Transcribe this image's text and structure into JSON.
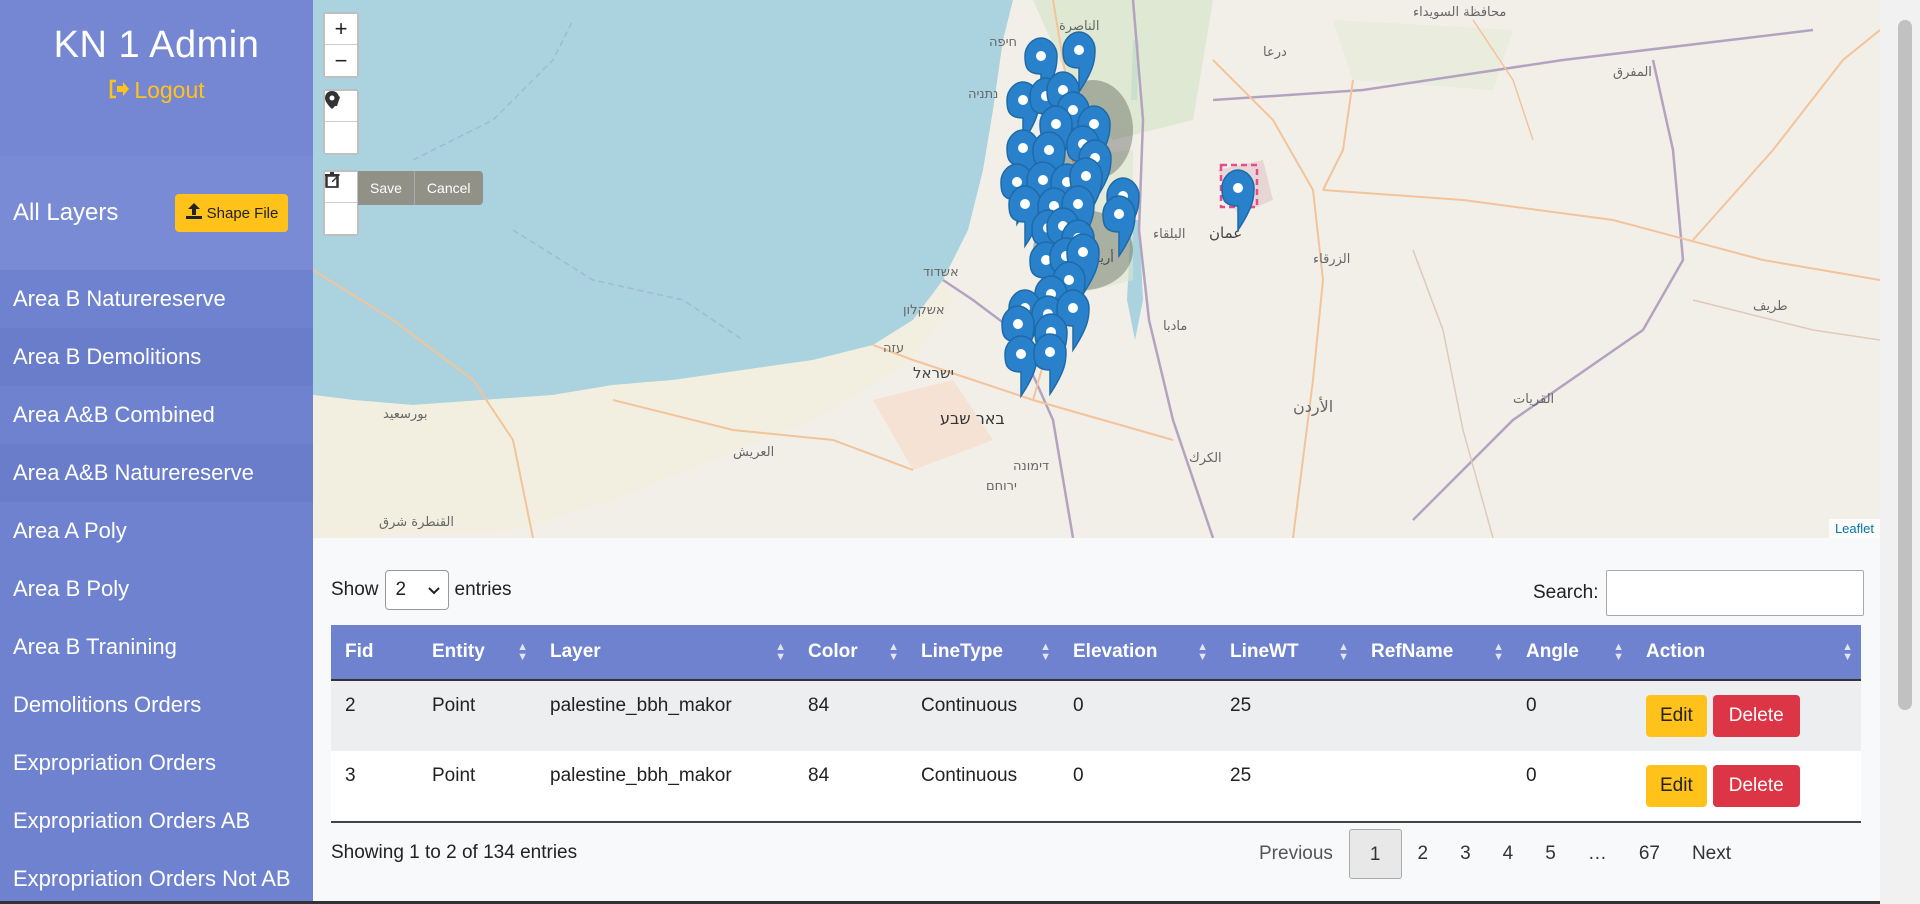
{
  "sidebar": {
    "title": "KN 1 Admin",
    "logout_label": "Logout",
    "all_layers_label": "All Layers",
    "shape_file_label": "Shape File",
    "items": [
      {
        "label": "Area B Naturereserve"
      },
      {
        "label": "Area B Demolitions"
      },
      {
        "label": "Area A&B Combined"
      },
      {
        "label": "Area A&B Naturereserve"
      },
      {
        "label": "Area A Poly"
      },
      {
        "label": "Area B Poly"
      },
      {
        "label": "Area B Tranining"
      },
      {
        "label": "Demolitions Orders"
      },
      {
        "label": "Expropriation Orders"
      },
      {
        "label": "Expropriation Orders AB"
      },
      {
        "label": "Expropriation Orders Not AB"
      }
    ]
  },
  "map": {
    "zoom_in": "+",
    "zoom_out": "−",
    "save_label": "Save",
    "cancel_label": "Cancel",
    "attribution": "Leaflet",
    "place_labels": [
      {
        "text": "محافظة السويداء"
      },
      {
        "text": "درعا"
      },
      {
        "text": "المفرق"
      },
      {
        "text": "عمان"
      },
      {
        "text": "الزرقاء"
      },
      {
        "text": "البلقاء"
      },
      {
        "text": "مادبا"
      },
      {
        "text": "الأردن"
      },
      {
        "text": "الكرك"
      },
      {
        "text": "القريات"
      },
      {
        "text": "طريف"
      },
      {
        "text": "באר שבע"
      },
      {
        "text": "ישראל"
      },
      {
        "text": "עזה"
      },
      {
        "text": "אשדוד"
      },
      {
        "text": "אשקלון"
      },
      {
        "text": "ירוחם"
      },
      {
        "text": "דימונה"
      },
      {
        "text": "بورسعيد"
      },
      {
        "text": "العريش"
      },
      {
        "text": "القنطرة شرق"
      },
      {
        "text": "أريحا"
      },
      {
        "text": "الناصرة"
      },
      {
        "text": "חיפה"
      },
      {
        "text": "נתניה"
      }
    ]
  },
  "table": {
    "show_label": "Show",
    "entries_label": "entries",
    "page_length": "2",
    "search_label": "Search:",
    "search_value": "",
    "columns": [
      "Fid",
      "Entity",
      "Layer",
      "Color",
      "LineType",
      "Elevation",
      "LineWT",
      "RefName",
      "Angle",
      "Action"
    ],
    "rows": [
      {
        "fid": "2",
        "entity": "Point",
        "layer": "palestine_bbh_makor",
        "color": "84",
        "linetype": "Continuous",
        "elevation": "0",
        "linewt": "25",
        "refname": "",
        "angle": "0"
      },
      {
        "fid": "3",
        "entity": "Point",
        "layer": "palestine_bbh_makor",
        "color": "84",
        "linetype": "Continuous",
        "elevation": "0",
        "linewt": "25",
        "refname": "",
        "angle": "0"
      }
    ],
    "edit_label": "Edit",
    "delete_label": "Delete",
    "info": "Showing 1 to 2 of 134 entries",
    "pagination": {
      "previous": "Previous",
      "pages": [
        "1",
        "2",
        "3",
        "4",
        "5",
        "…",
        "67"
      ],
      "next": "Next",
      "current": "1"
    }
  },
  "colors": {
    "sidebar": "#6f82cf",
    "accent_yellow": "#ffc21a",
    "danger_red": "#dc3545",
    "marker_blue": "#2a81cb",
    "sea": "#aad3df"
  }
}
